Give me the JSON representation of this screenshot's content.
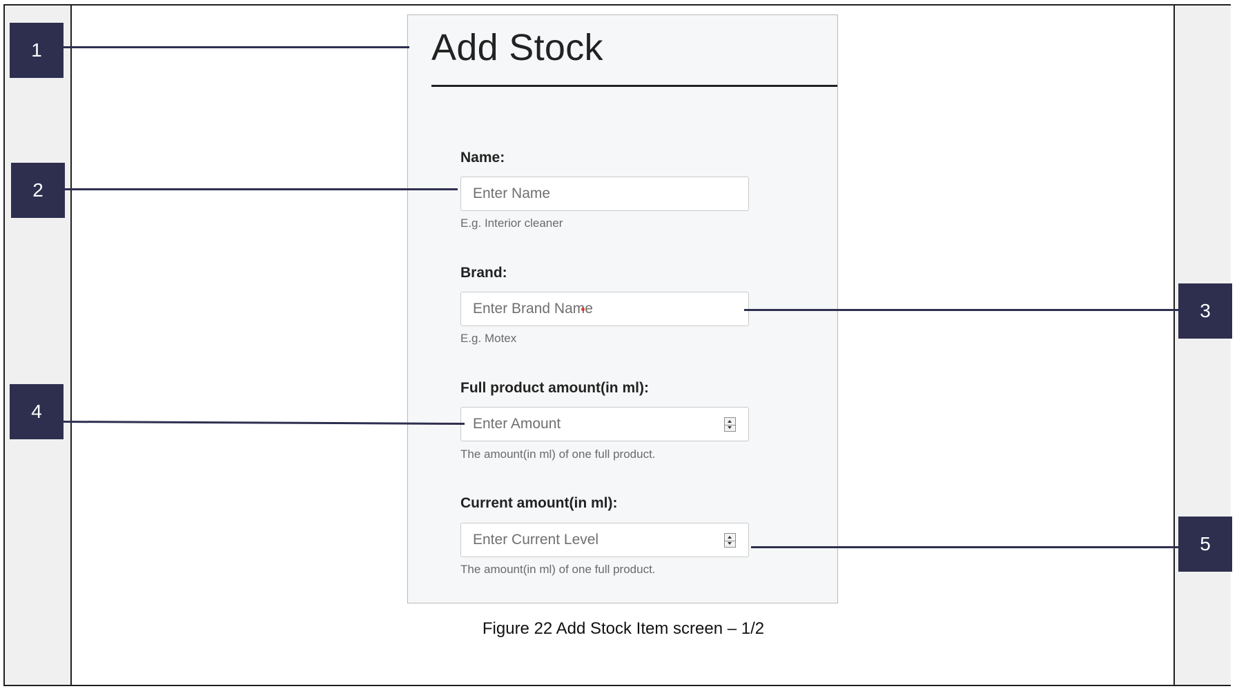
{
  "form": {
    "title": "Add Stock",
    "fields": [
      {
        "label": "Name:",
        "placeholder": "Enter Name",
        "help": "E.g. Interior cleaner",
        "type": "text"
      },
      {
        "label": "Brand:",
        "placeholder": "Enter Brand Name",
        "help": "E.g. Motex",
        "type": "text"
      },
      {
        "label": "Full product amount(in ml):",
        "placeholder": "Enter Amount",
        "help": "The amount(in ml) of one full product.",
        "type": "number"
      },
      {
        "label": "Current amount(in ml):",
        "placeholder": "Enter Current Level",
        "help": "The amount(in ml) of one full product.",
        "type": "number"
      }
    ]
  },
  "callouts": [
    "1",
    "2",
    "3",
    "4",
    "5"
  ],
  "caption": "Figure 22 Add Stock Item screen – 1/2",
  "colors": {
    "callout": "#2e2f4f",
    "panel": "#f6f7f8",
    "accent_dot": "#d83a2e"
  },
  "icons": {
    "spinner": "number-spinner-icon"
  }
}
